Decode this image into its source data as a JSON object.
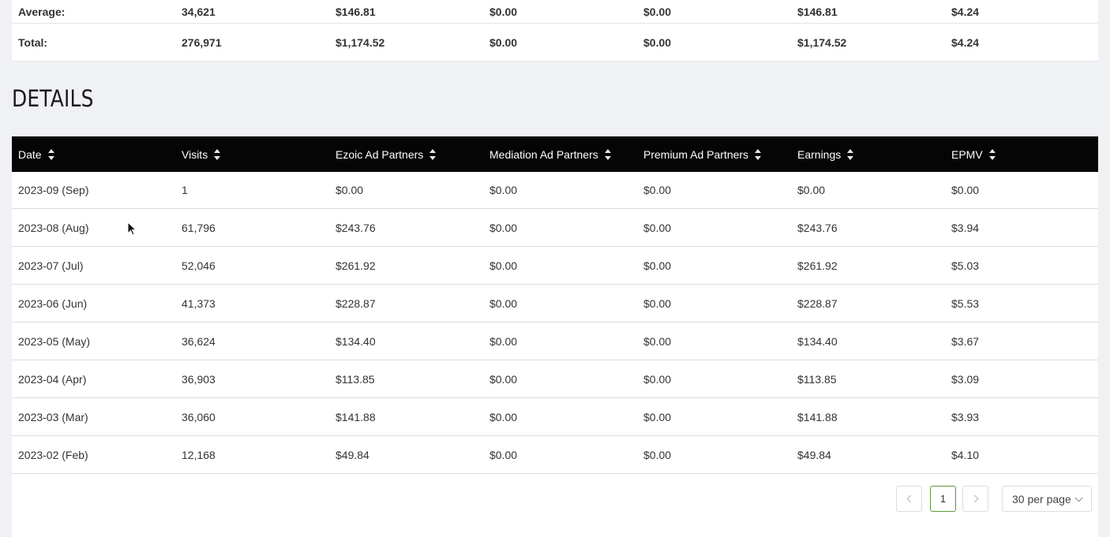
{
  "summary": {
    "average": [
      "Average:",
      "34,621",
      "$146.81",
      "$0.00",
      "$0.00",
      "$146.81",
      "$4.24"
    ],
    "total": [
      "Total:",
      "276,971",
      "$1,174.52",
      "$0.00",
      "$0.00",
      "$1,174.52",
      "$4.24"
    ]
  },
  "details": {
    "title": "DETAILS",
    "columns": [
      "Date",
      "Visits",
      "Ezoic Ad Partners",
      "Mediation Ad Partners",
      "Premium Ad Partners",
      "Earnings",
      "EPMV"
    ],
    "rows": [
      [
        "2023-09 (Sep)",
        "1",
        "$0.00",
        "$0.00",
        "$0.00",
        "$0.00",
        "$0.00"
      ],
      [
        "2023-08 (Aug)",
        "61,796",
        "$243.76",
        "$0.00",
        "$0.00",
        "$243.76",
        "$3.94"
      ],
      [
        "2023-07 (Jul)",
        "52,046",
        "$261.92",
        "$0.00",
        "$0.00",
        "$261.92",
        "$5.03"
      ],
      [
        "2023-06 (Jun)",
        "41,373",
        "$228.87",
        "$0.00",
        "$0.00",
        "$228.87",
        "$5.53"
      ],
      [
        "2023-05 (May)",
        "36,624",
        "$134.40",
        "$0.00",
        "$0.00",
        "$134.40",
        "$3.67"
      ],
      [
        "2023-04 (Apr)",
        "36,903",
        "$113.85",
        "$0.00",
        "$0.00",
        "$113.85",
        "$3.09"
      ],
      [
        "2023-03 (Mar)",
        "36,060",
        "$141.88",
        "$0.00",
        "$0.00",
        "$141.88",
        "$3.93"
      ],
      [
        "2023-02 (Feb)",
        "12,168",
        "$49.84",
        "$0.00",
        "$0.00",
        "$49.84",
        "$4.10"
      ]
    ]
  },
  "pagination": {
    "current_page": "1",
    "per_page_label": "30 per page",
    "prev_icon": "chevron-left-icon",
    "next_icon": "chevron-right-icon"
  },
  "colors": {
    "header_bg": "#050505",
    "active_page_border": "#5a9a3a",
    "page_bg": "#f0f1f5"
  }
}
